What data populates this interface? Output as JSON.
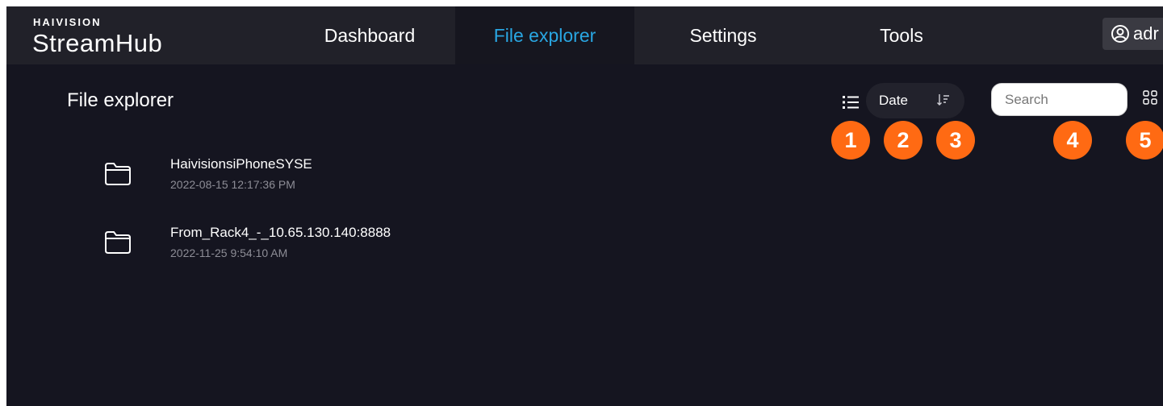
{
  "brand": {
    "company": "HAIVISION",
    "product": "StreamHub"
  },
  "nav": {
    "tabs": [
      {
        "label": "Dashboard",
        "active": false
      },
      {
        "label": "File explorer",
        "active": true
      },
      {
        "label": "Settings",
        "active": false
      },
      {
        "label": "Tools",
        "active": false
      }
    ],
    "user_label": "adr"
  },
  "page": {
    "title": "File explorer"
  },
  "toolbar": {
    "list_view_icon": "list-icon",
    "sort_field": "Date",
    "sort_direction_icon": "sort-descending-icon",
    "search_placeholder": "Search",
    "search_value": "",
    "grid_view_icon": "grid-icon"
  },
  "annotations": [
    "1",
    "2",
    "3",
    "4",
    "5"
  ],
  "files": [
    {
      "name": "HaivisionsiPhoneSYSE",
      "date": "2022-08-15 12:17:36 PM",
      "icon": "folder-icon"
    },
    {
      "name": "From_Rack4_-_10.65.130.140:8888",
      "date": "2022-11-25 9:54:10 AM",
      "icon": "folder-icon"
    }
  ],
  "colors": {
    "accent": "#29a6e2",
    "badge": "#ff6a13",
    "background": "#151520",
    "topbar": "#212129"
  }
}
